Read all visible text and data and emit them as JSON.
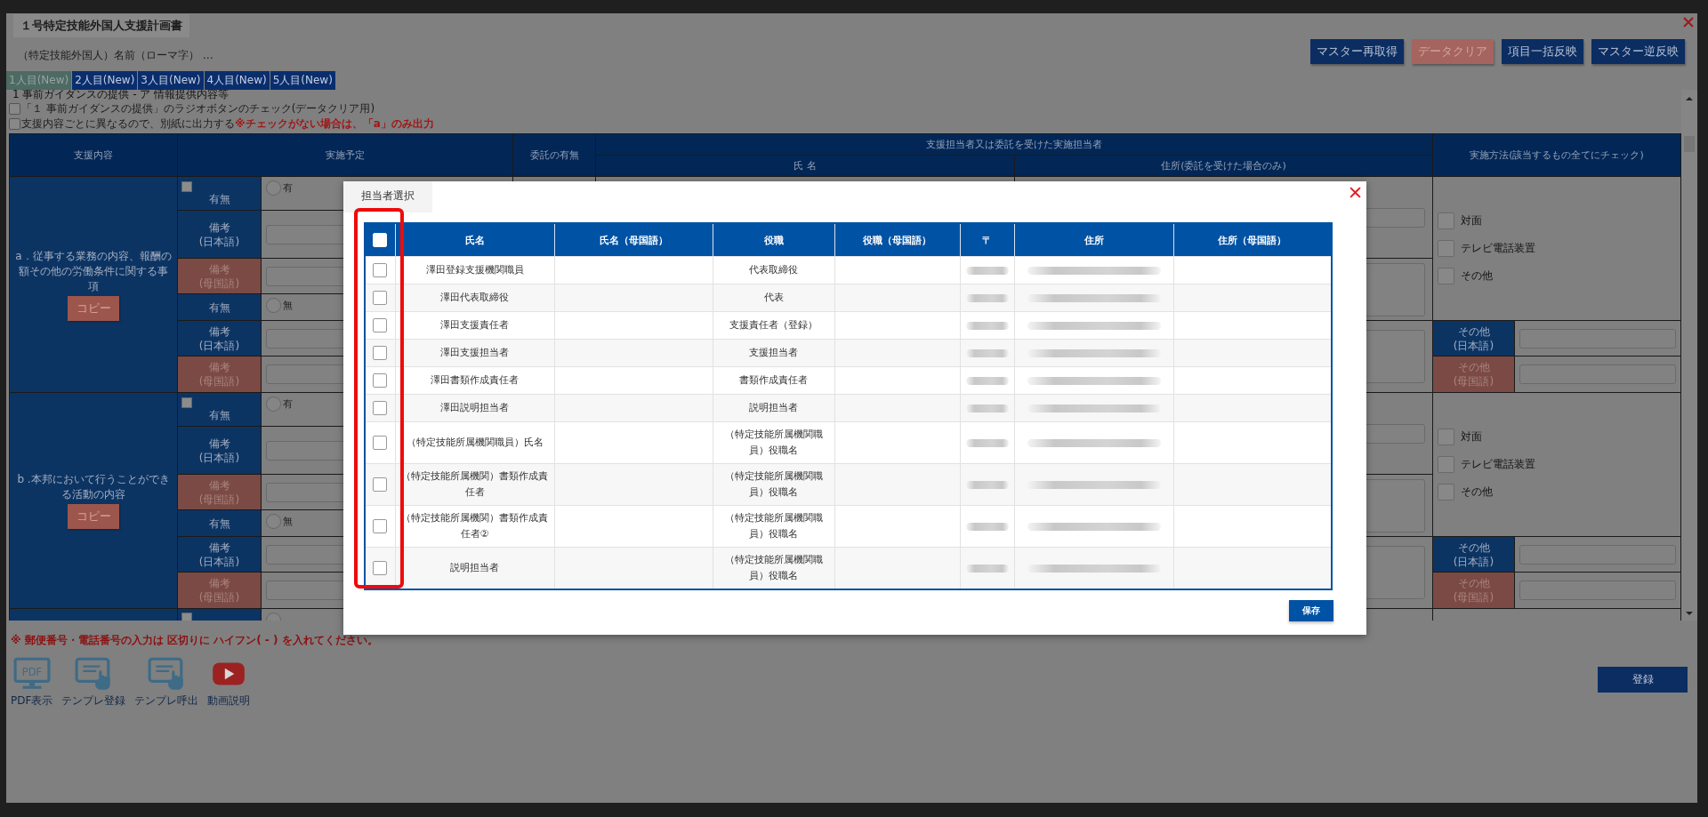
{
  "window": {
    "title": "１号特定技能外国人支援計画書"
  },
  "person_name_label": "（特定技能外国人）名前（ローマ字） …",
  "toolbar_buttons": [
    {
      "label": "マスター再取得",
      "kind": "primary"
    },
    {
      "label": "データクリア",
      "kind": "danger"
    },
    {
      "label": "項目一括反映",
      "kind": "primary"
    },
    {
      "label": "マスター逆反映",
      "kind": "primary"
    }
  ],
  "tabs": [
    {
      "label": "1人目(New)",
      "selected": true
    },
    {
      "label": "2人目(New)",
      "selected": false
    },
    {
      "label": "3人目(New)",
      "selected": false
    },
    {
      "label": "4人目(New)",
      "selected": false
    },
    {
      "label": "5人目(New)",
      "selected": false
    }
  ],
  "section_title": "1 事前ガイダンスの提供 - ア 情報提供内容等",
  "options": [
    {
      "label": "「１ 事前ガイダンスの提供」のラジオボタンのチェック(データクリア用)",
      "checked": false
    },
    {
      "label": "支援内容ごとに異なるので、別紙に出力する",
      "warning": "※チェックがない場合は、「a」のみ出力",
      "checked": false
    }
  ],
  "plan_table": {
    "columns": {
      "support_content": "支援内容",
      "schedule": "実施予定",
      "delegation": "委託の有無",
      "person_in_charge": "支援担当者又は委託を受けた実施担当者",
      "name": "氏 名",
      "address": "住所(委託を受けた場合のみ)",
      "method": "実施方法(該当するもの全てにチェック)"
    },
    "sections": [
      {
        "label": "a．従事する業務の内容、報酬の額その他の労働条件に関する事項",
        "copy_button": "コピー",
        "rows": [
          {
            "kind": "yesno",
            "label": "有無",
            "checked": false,
            "option": "有",
            "selected": false
          },
          {
            "kind": "note_ja",
            "label": "備考\n(日本語)"
          },
          {
            "kind": "note_native",
            "label": "備考\n(母国語)"
          },
          {
            "kind": "yesno",
            "label": "有無",
            "option": "無",
            "selected": false
          },
          {
            "kind": "note_ja",
            "label": "備考\n(日本語)"
          },
          {
            "kind": "note_native",
            "label": "備考\n(母国語)"
          }
        ],
        "methods": [
          {
            "label": "対面",
            "checked": false
          },
          {
            "label": "テレビ電話装置",
            "checked": false
          },
          {
            "label": "その他",
            "checked": false
          }
        ],
        "method_notes": [
          {
            "kind": "note_ja",
            "label": "その他\n(日本語)"
          },
          {
            "kind": "note_native",
            "label": "その他\n(母国語)"
          }
        ]
      },
      {
        "label": "b .本邦において行うことができる活動の内容",
        "copy_button": "コピー",
        "rows": [
          {
            "kind": "yesno",
            "label": "有無",
            "checked": false,
            "option": "有",
            "selected": false
          },
          {
            "kind": "note_ja",
            "label": "備考\n(日本語)"
          },
          {
            "kind": "note_native",
            "label": "備考\n(母国語)"
          },
          {
            "kind": "yesno",
            "label": "有無",
            "option": "無",
            "selected": false
          },
          {
            "kind": "note_ja",
            "label": "備考\n(日本語)"
          },
          {
            "kind": "note_native",
            "label": "備考\n(母国語)"
          }
        ],
        "methods": [
          {
            "label": "対面",
            "checked": false
          },
          {
            "label": "テレビ電話装置",
            "checked": false
          },
          {
            "label": "その他",
            "checked": false
          }
        ],
        "method_notes": [
          {
            "kind": "note_ja",
            "label": "その他\n(日本語)"
          },
          {
            "kind": "note_native",
            "label": "その他\n(母国語)"
          }
        ]
      },
      {
        "rows": [
          {
            "kind": "yesno",
            "checked": false,
            "selected": false
          }
        ]
      }
    ]
  },
  "footer_note": "※ 郵便番号・電話番号の入力は 区切りに ハイフン( - ) を入れてください。",
  "footer_tools": [
    {
      "label": "PDF表示",
      "kind": "pdf",
      "icon_text": "PDF"
    },
    {
      "label": "テンプレ登録",
      "kind": "template"
    },
    {
      "label": "テンプレ呼出",
      "kind": "template"
    },
    {
      "label": "動画説明",
      "kind": "video"
    }
  ],
  "register_button": "登録",
  "dialog": {
    "title": "担当者選択",
    "select_all_checked": false,
    "highlight_checkbox_column": true,
    "columns": [
      "氏名",
      "氏名（母国語）",
      "役職",
      "役職（母国語）",
      "〒",
      "住所",
      "住所（母国語）"
    ],
    "rows": [
      {
        "name": "澤田登録支援機関職員",
        "role": "代表取締役",
        "checked": false,
        "redacted": true
      },
      {
        "name": "澤田代表取締役",
        "role": "代表",
        "checked": false,
        "redacted": true
      },
      {
        "name": "澤田支援責任者",
        "role": "支援責任者（登録）",
        "checked": false,
        "redacted": true
      },
      {
        "name": "澤田支援担当者",
        "role": "支援担当者",
        "checked": false,
        "redacted": true
      },
      {
        "name": "澤田書類作成責任者",
        "role": "書類作成責任者",
        "checked": false,
        "redacted": true
      },
      {
        "name": "澤田説明担当者",
        "role": "説明担当者",
        "checked": false,
        "redacted": true
      },
      {
        "name": "（特定技能所属機関職員）氏名",
        "role": "（特定技能所属機関職員）役職名",
        "checked": false,
        "redacted": true
      },
      {
        "name": "（特定技能所属機関）書類作成責任者",
        "role": "（特定技能所属機関職員）役職名",
        "checked": false,
        "redacted": true
      },
      {
        "name": "（特定技能所属機関）書類作成責任者②",
        "role": "（特定技能所属機関職員）役職名",
        "checked": false,
        "redacted": true
      },
      {
        "name": "説明担当者",
        "role": "（特定技能所属機関職員）役職名",
        "checked": false,
        "redacted": true
      }
    ],
    "save_button": "保存"
  }
}
